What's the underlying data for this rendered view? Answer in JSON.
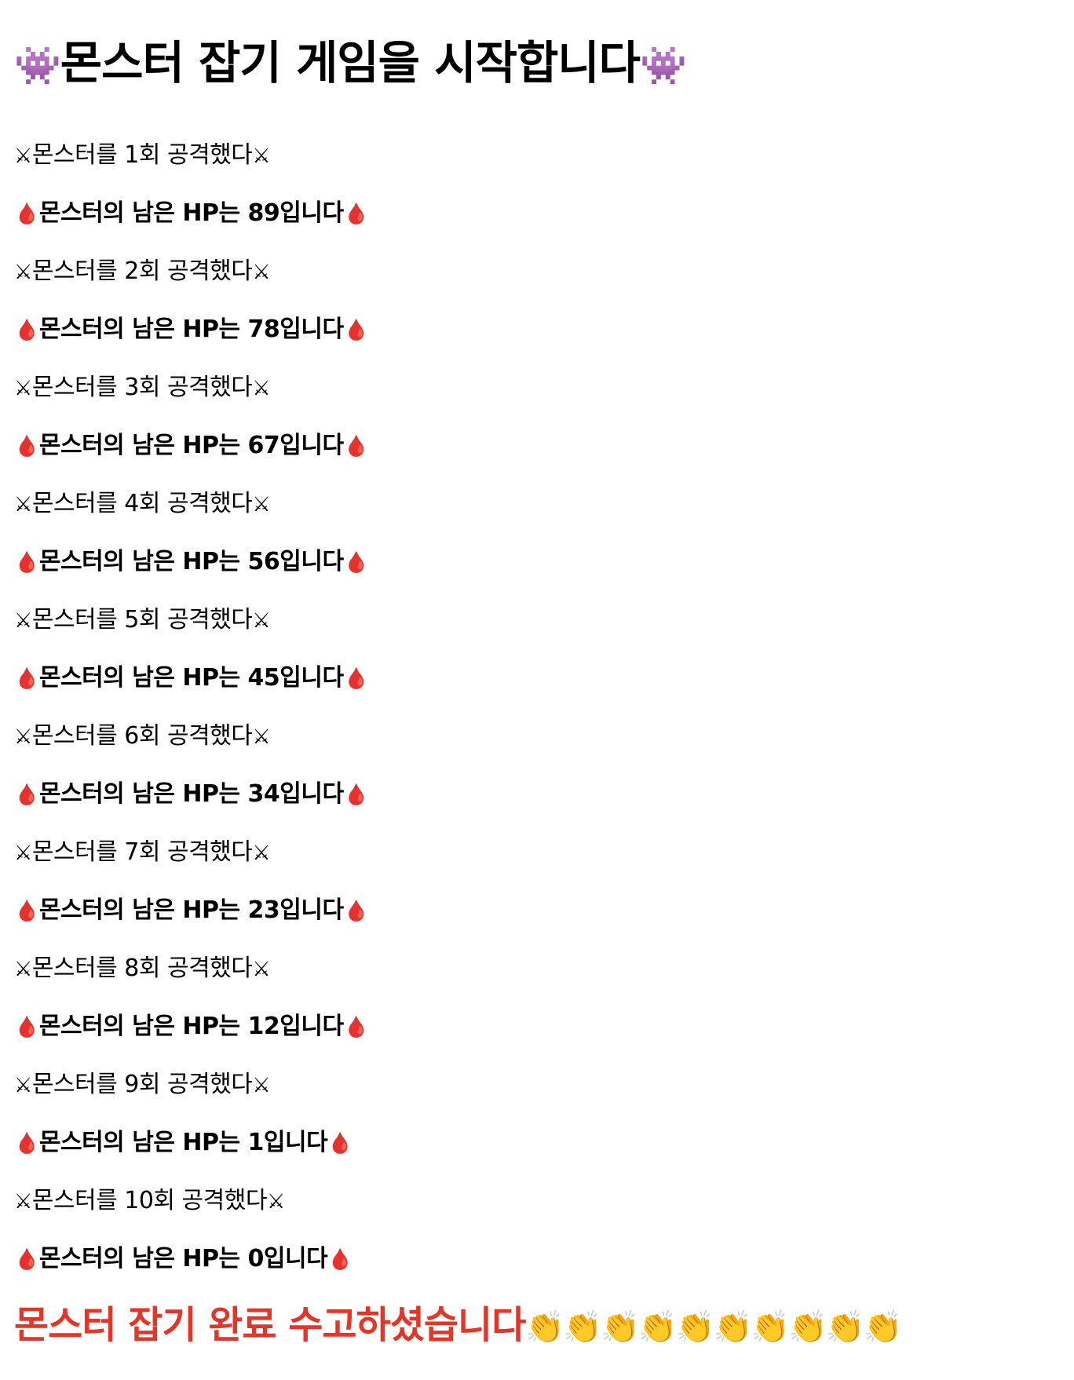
{
  "header": {
    "title": "몬스터 잡기 게임을 시작합니다",
    "icon": "👾"
  },
  "log": [
    {
      "attack": "몬스터를 1회 공격했다",
      "hp": "몬스터의 남은 HP는 89입니다"
    },
    {
      "attack": "몬스터를 2회 공격했다",
      "hp": "몬스터의 남은 HP는 78입니다"
    },
    {
      "attack": "몬스터를 3회 공격했다",
      "hp": "몬스터의 남은 HP는 67입니다"
    },
    {
      "attack": "몬스터를 4회 공격했다",
      "hp": "몬스터의 남은 HP는 56입니다"
    },
    {
      "attack": "몬스터를 5회 공격했다",
      "hp": "몬스터의 남은 HP는 45입니다"
    },
    {
      "attack": "몬스터를 6회 공격했다",
      "hp": "몬스터의 남은 HP는 34입니다"
    },
    {
      "attack": "몬스터를 7회 공격했다",
      "hp": "몬스터의 남은 HP는 23입니다"
    },
    {
      "attack": "몬스터를 8회 공격했다",
      "hp": "몬스터의 남은 HP는 12입니다"
    },
    {
      "attack": "몬스터를 9회 공격했다",
      "hp": "몬스터의 남은 HP는 1입니다"
    },
    {
      "attack": "몬스터를 10회 공격했다",
      "hp": "몬스터의 남은 HP는 0입니다"
    }
  ],
  "icons": {
    "attack": "⚔",
    "hp": "🩸",
    "clap": "👏"
  },
  "footer": {
    "message": "몬스터 잡기 완료 수고하셨습니다",
    "color": "#e53527",
    "clap_count": 10
  }
}
